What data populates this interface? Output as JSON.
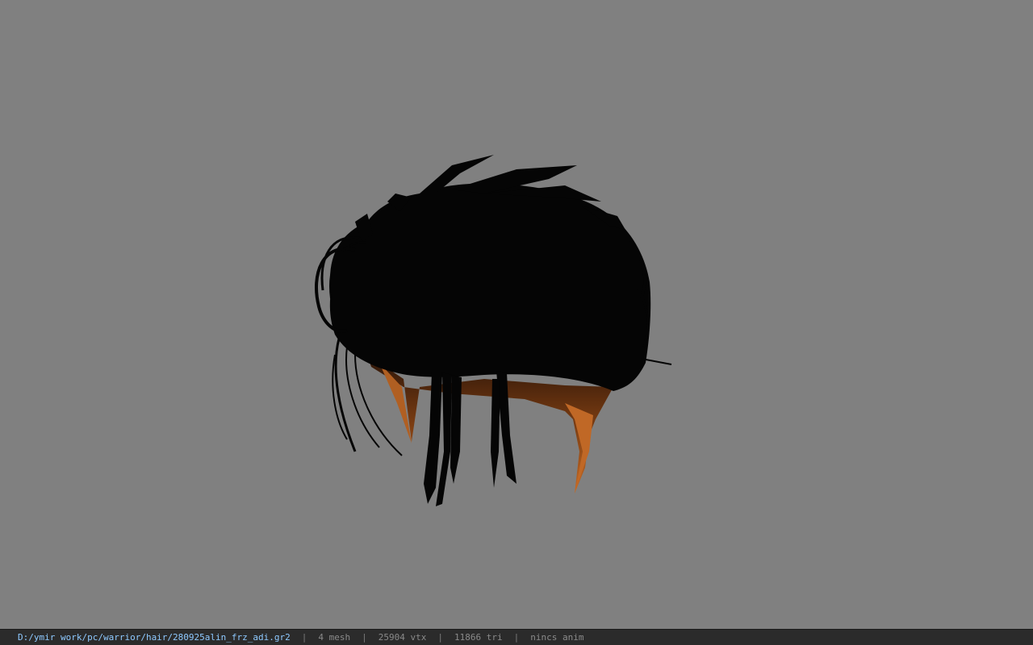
{
  "viewer": {
    "background_color": "#808080",
    "model": {
      "icon": "hair-mesh-model",
      "colors": {
        "hair": "#050505",
        "skin_top": "#2a1408",
        "skin_bottom": "#c56a24"
      }
    }
  },
  "status_bar": {
    "file_path": "D:/ymir work/pc/warrior/hair/280925alin_frz_adi.gr2",
    "separator": "|",
    "mesh": "4 mesh",
    "vertices": "25904 vtx",
    "triangles": "11866 tri",
    "anim": "nincs anim",
    "colors": {
      "background": "#2b2b2b",
      "path_text": "#8ec9ff",
      "stat_text": "#8a8a8a"
    }
  }
}
